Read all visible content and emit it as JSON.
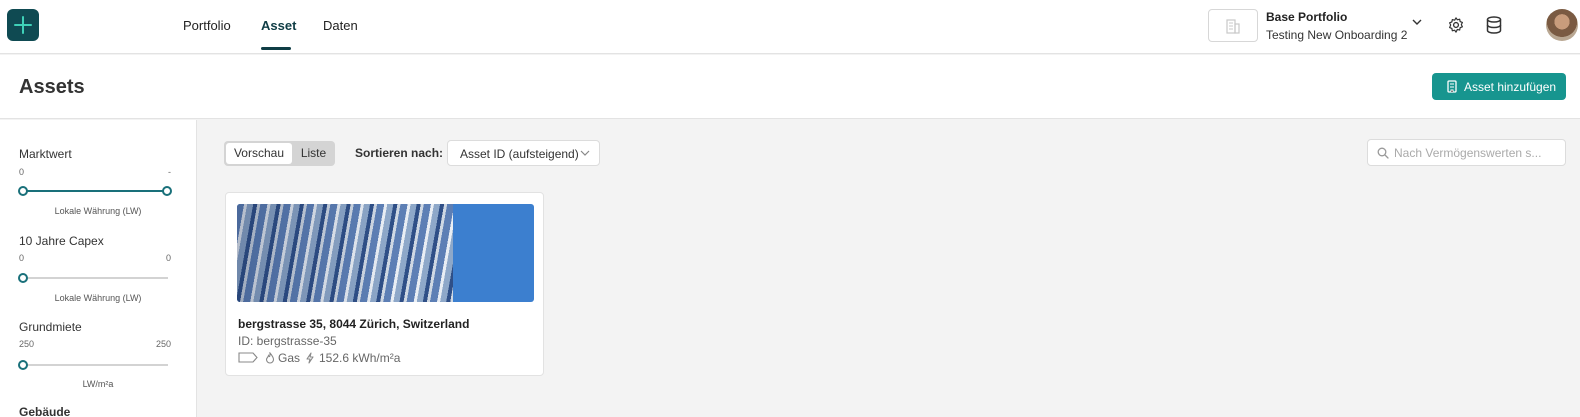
{
  "nav": {
    "tabs": [
      {
        "label": "Portfolio"
      },
      {
        "label": "Asset"
      },
      {
        "label": "Daten"
      }
    ],
    "active_tab": "Asset",
    "portfolio": {
      "title": "Base Portfolio",
      "subtitle": "Testing New Onboarding 2"
    },
    "icons": [
      "logo-plus-icon",
      "building-icon",
      "chevron-down-icon",
      "gear-icon",
      "database-icon",
      "avatar"
    ]
  },
  "header": {
    "title": "Assets",
    "add_button": "Asset hinzufügen"
  },
  "filters": [
    {
      "title": "Marktwert",
      "min": "0",
      "max": "-",
      "unit": "Lokale Währung (LW)"
    },
    {
      "title": "10 Jahre Capex",
      "min": "0",
      "max": "0",
      "unit": "Lokale Währung (LW)"
    },
    {
      "title": "Grundmiete",
      "min": "250",
      "max": "250",
      "unit": "LW/m²a"
    },
    {
      "title": "Gebäude"
    }
  ],
  "toolbar": {
    "view_options": [
      "Vorschau",
      "Liste"
    ],
    "selected_view": "Vorschau",
    "sort_label": "Sortieren nach:",
    "sort_value": "Asset ID (aufsteigend)",
    "search_placeholder": "Nach Vermögenswerten s..."
  },
  "assets": [
    {
      "title": "bergstrasse 35, 8044 Zürich, Switzerland",
      "id_text": "ID: bergstrasse-35",
      "heating": "Gas",
      "energy": "152.6 kWh/m²a"
    }
  ],
  "colors": {
    "brand_dark": "#0f4a52",
    "accent": "#17958f",
    "slider": "#19707a"
  }
}
